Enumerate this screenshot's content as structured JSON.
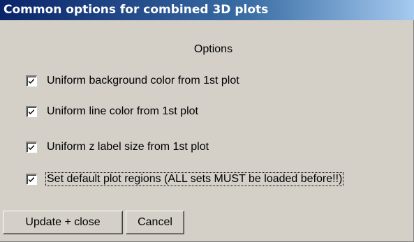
{
  "window": {
    "title": "Common options for combined 3D plots"
  },
  "options_group": {
    "label": "Options",
    "items": [
      {
        "label": "Uniform background color from 1st plot",
        "checked": true
      },
      {
        "label": "Uniform line color from 1st plot",
        "checked": true
      },
      {
        "label": "Uniform z label size from 1st plot",
        "checked": true
      },
      {
        "label": "Set default plot regions (ALL sets MUST be loaded before!!)",
        "checked": true,
        "focused": true
      }
    ]
  },
  "buttons": {
    "update_close_label": "Update + close",
    "cancel_label": "Cancel"
  },
  "colors": {
    "titlebar_start": "#0a246a",
    "titlebar_end": "#a6caf0",
    "face": "#d4d0c8"
  }
}
